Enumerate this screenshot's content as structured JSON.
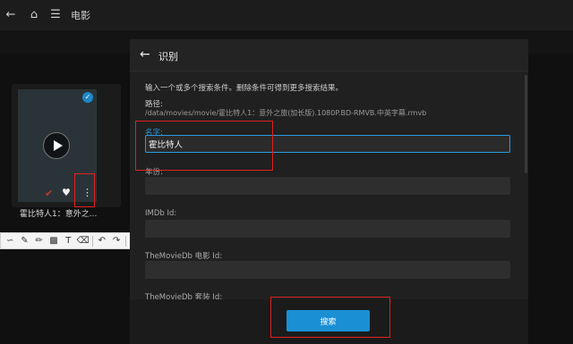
{
  "header": {
    "title": "电影",
    "back_icon": "arrow-left-icon",
    "home_icon": "home-icon",
    "menu_icon": "hamburger-menu-icon"
  },
  "card": {
    "title": "霍比特人1：意外之..."
  },
  "dialog": {
    "title": "识别",
    "intro": "输入一个或多个搜索条件。删除条件可得到更多搜索结果。",
    "path_label": "路径:",
    "path_value": "/data/movies/movie/霍比特人1：意外之旅(加长版).1080P.BD-RMVB.中英字幕.rmvb",
    "fields": [
      {
        "label": "名字:",
        "value": "霍比特人"
      },
      {
        "label": "年份:",
        "value": ""
      },
      {
        "label": "IMDb Id:",
        "value": ""
      },
      {
        "label": "TheMovieDb 电影 Id:",
        "value": ""
      },
      {
        "label": "TheMovieDb 套装 Id:",
        "value": ""
      }
    ],
    "search_label": "搜索"
  },
  "toolbar_tools": [
    "freehand-icon",
    "pencil-icon",
    "highlighter-icon",
    "mosaic-icon",
    "text-icon",
    "eraser-icon",
    "undo-icon",
    "redo-icon",
    "save-icon",
    "copy-icon",
    "confirm-icon"
  ],
  "colors": {
    "accent": "#1b8fd4",
    "annotation": "#e02020"
  }
}
